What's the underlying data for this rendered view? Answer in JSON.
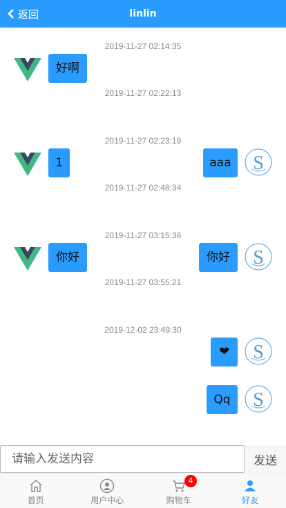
{
  "header": {
    "back_label": "返回",
    "title": "linlin"
  },
  "messages": [
    {
      "time": "2019-11-27 02:14:35",
      "side": "left",
      "text": "好啊"
    },
    {
      "time": "2019-11-27 02:22:13",
      "side": "right",
      "text": "aaa"
    },
    {
      "time": "2019-11-27 02:23:19",
      "side": "left",
      "text": "1"
    },
    {
      "time": "2019-11-27 02:48:34",
      "side": "right",
      "text": "你好"
    },
    {
      "time": "2019-11-27 03:15:38",
      "side": "left",
      "text": "你好"
    },
    {
      "time": "2019-11-27 03:55:21",
      "side": "right",
      "text": "❤",
      "emoji": "heart-icon"
    },
    {
      "time": "2019-12-02 23:49:30",
      "side": "right",
      "text": "Qq"
    }
  ],
  "input": {
    "placeholder": "请输入发送内容",
    "value": ""
  },
  "send_label": "发送",
  "tabs": [
    {
      "label": "首页",
      "icon": "home-icon"
    },
    {
      "label": "用户中心",
      "icon": "user-center-icon"
    },
    {
      "label": "购物车",
      "icon": "cart-icon",
      "badge": "4"
    },
    {
      "label": "好友",
      "icon": "friend-icon",
      "active": true
    }
  ],
  "colors": {
    "accent": "#2a9cff",
    "badge": "#ff0000"
  }
}
